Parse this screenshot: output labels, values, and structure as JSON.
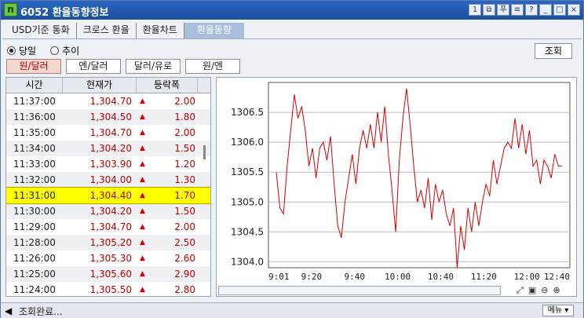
{
  "window": {
    "title": "6052 환율동향정보",
    "logo": "n"
  },
  "title_buttons": [
    "1",
    "⧉",
    "푸",
    "≡",
    "?",
    "_",
    "□",
    "×"
  ],
  "tabs": {
    "t1": "USD기준 통화",
    "t2": "크로스 환율",
    "t3": "환율차트",
    "t4": "환율동향"
  },
  "radio": {
    "daily": "당일",
    "trend": "추이"
  },
  "pairs": {
    "p1": "원/달러",
    "p2": "엔/달러",
    "p3": "달러/유로",
    "p4": "원/엔"
  },
  "query_label": "조회",
  "table": {
    "headers": {
      "time": "시간",
      "price": "현재가",
      "change": "등락폭"
    },
    "rows": [
      {
        "time": "11:37:00",
        "price": "1,304.70",
        "change": "2.00"
      },
      {
        "time": "11:36:00",
        "price": "1,304.50",
        "change": "1.80"
      },
      {
        "time": "11:35:00",
        "price": "1,304.70",
        "change": "2.00"
      },
      {
        "time": "11:34:00",
        "price": "1,304.20",
        "change": "1.50"
      },
      {
        "time": "11:33:00",
        "price": "1,303.90",
        "change": "1.20"
      },
      {
        "time": "11:32:00",
        "price": "1,304.00",
        "change": "1.30"
      },
      {
        "time": "11:31:00",
        "price": "1,304.40",
        "change": "1.70"
      },
      {
        "time": "11:30:00",
        "price": "1,304.20",
        "change": "1.50"
      },
      {
        "time": "11:29:00",
        "price": "1,304.70",
        "change": "2.00"
      },
      {
        "time": "11:28:00",
        "price": "1,305.20",
        "change": "2.50"
      },
      {
        "time": "11:26:00",
        "price": "1,305.30",
        "change": "2.60"
      },
      {
        "time": "11:25:00",
        "price": "1,305.60",
        "change": "2.90"
      },
      {
        "time": "11:24:00",
        "price": "1,305.50",
        "change": "2.80"
      }
    ]
  },
  "chart_data": {
    "type": "line",
    "x_ticks": [
      "9:01",
      "9:20",
      "9:40",
      "10:00",
      "10:40",
      "11:20",
      "12:00",
      "12:40"
    ],
    "y_ticks": [
      "1304.0",
      "1304.5",
      "1305.0",
      "1305.5",
      "1306.0",
      "1306.5"
    ],
    "ylim": [
      1303.9,
      1307.0
    ],
    "line_color": "#d40000",
    "values": [
      1305.5,
      1304.9,
      1304.8,
      1305.6,
      1306.2,
      1306.8,
      1306.4,
      1306.6,
      1306.2,
      1305.6,
      1305.9,
      1305.4,
      1305.9,
      1306.0,
      1305.7,
      1306.1,
      1305.3,
      1304.6,
      1304.4,
      1305.0,
      1305.4,
      1305.8,
      1305.3,
      1305.9,
      1306.2,
      1305.9,
      1306.3,
      1305.9,
      1306.5,
      1306.0,
      1306.6,
      1305.8,
      1305.2,
      1304.5,
      1305.7,
      1306.4,
      1306.9,
      1306.3,
      1305.6,
      1305.0,
      1305.2,
      1304.9,
      1305.4,
      1304.7,
      1305.3,
      1305.0,
      1305.2,
      1304.8,
      1304.6,
      1304.9,
      1303.9,
      1304.6,
      1304.2,
      1304.9,
      1304.5,
      1305.0,
      1304.6,
      1305.0,
      1305.3,
      1305.1,
      1305.7,
      1305.3,
      1305.6,
      1305.9,
      1306.0,
      1305.9,
      1306.4,
      1305.9,
      1306.3,
      1305.8,
      1306.2,
      1305.6,
      1305.7,
      1305.3,
      1305.7,
      1305.6,
      1305.4,
      1305.8,
      1305.6,
      1305.6
    ]
  },
  "status": {
    "text": "조회완료...",
    "menu": "메뉴 ▾"
  }
}
